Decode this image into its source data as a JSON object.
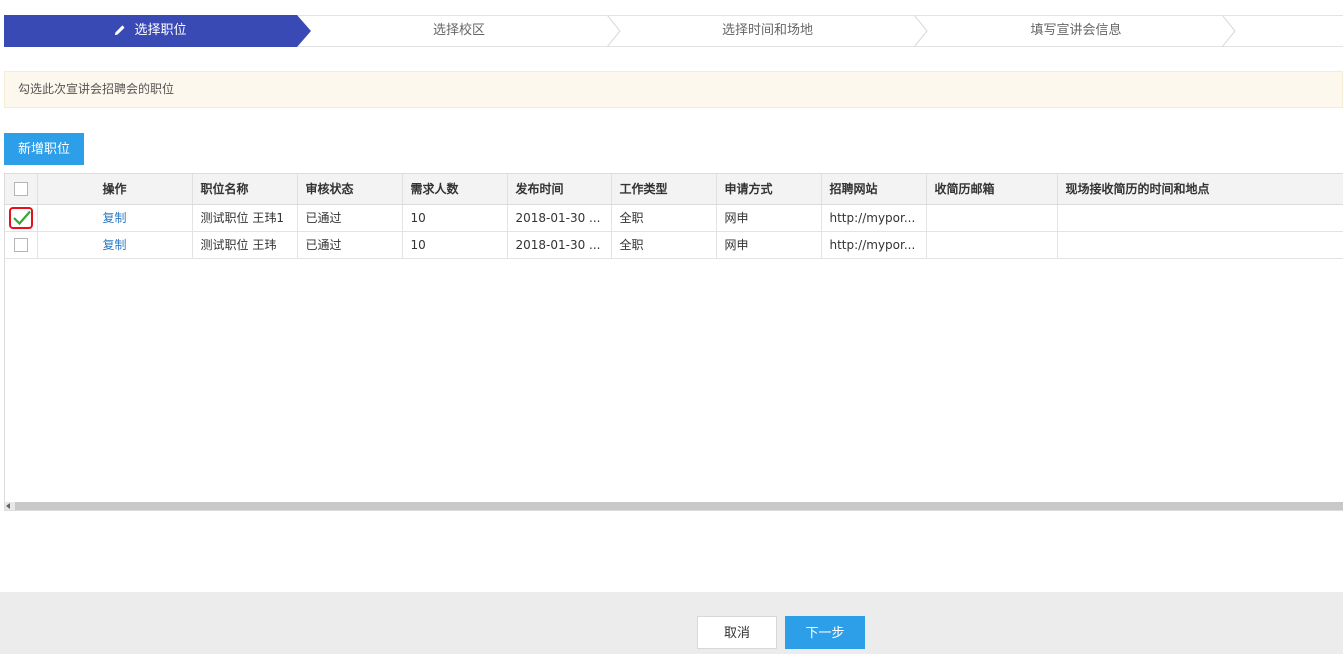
{
  "steps": [
    {
      "label": "选择职位",
      "active": true
    },
    {
      "label": "选择校区",
      "active": false
    },
    {
      "label": "选择时间和场地",
      "active": false
    },
    {
      "label": "填写宣讲会信息",
      "active": false
    }
  ],
  "notice": "勾选此次宣讲会招聘会的职位",
  "add_button": "新增职位",
  "table": {
    "headers": [
      "操作",
      "职位名称",
      "审核状态",
      "需求人数",
      "发布时间",
      "工作类型",
      "申请方式",
      "招聘网站",
      "收简历邮箱",
      "现场接收简历的时间和地点"
    ],
    "rows": [
      {
        "checked": true,
        "op": "复制",
        "name": "测试职位 王玮1",
        "status": "已通过",
        "count": "10",
        "time": "2018-01-30 ...",
        "type": "全职",
        "apply": "网申",
        "site": "http://mypor...",
        "email": "",
        "onsite": ""
      },
      {
        "checked": false,
        "op": "复制",
        "name": "测试职位 王玮",
        "status": "已通过",
        "count": "10",
        "time": "2018-01-30 ...",
        "type": "全职",
        "apply": "网申",
        "site": "http://mypor...",
        "email": "",
        "onsite": ""
      }
    ]
  },
  "footer": {
    "cancel": "取消",
    "next": "下一步"
  },
  "colors": {
    "accent": "#3a4ab5",
    "primary_button": "#2d9ee8",
    "link": "#2d7cc1",
    "checked_highlight": "#e8101a",
    "check_mark": "#3aa33a"
  },
  "icons": {
    "step_active": "pencil-icon",
    "row_checked": "check-icon"
  }
}
